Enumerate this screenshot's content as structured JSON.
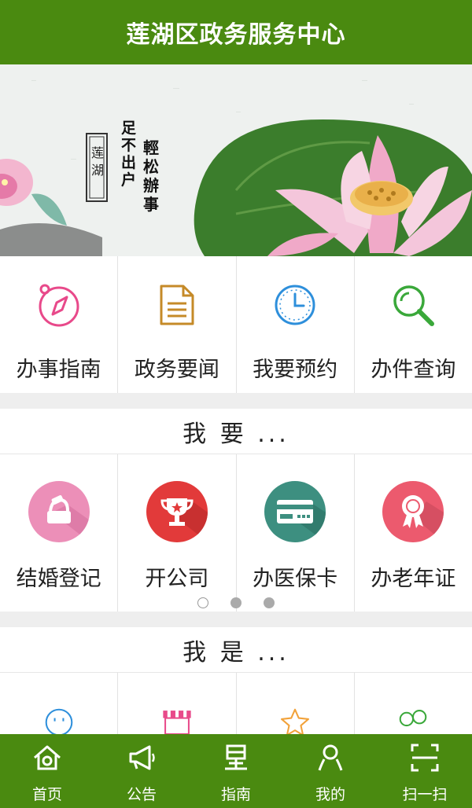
{
  "header": {
    "title": "莲湖区政务服务中心"
  },
  "banner": {
    "seal_text": "莲湖",
    "slogan_left": "足不出户",
    "slogan_right": "輕松辦事"
  },
  "quick_menu": [
    {
      "label": "办事指南",
      "icon": "compass-icon",
      "color": "#e8498a"
    },
    {
      "label": "政务要闻",
      "icon": "document-icon",
      "color": "#c58a28"
    },
    {
      "label": "我要预约",
      "icon": "clock-icon",
      "color": "#2e8fdb"
    },
    {
      "label": "办件查询",
      "icon": "search-icon",
      "color": "#3aa83a"
    }
  ],
  "want_section": {
    "title": "我 要 ...",
    "items": [
      {
        "label": "结婚登记",
        "icon": "ring-box-icon",
        "color": "#ec8fb8"
      },
      {
        "label": "开公司",
        "icon": "trophy-icon",
        "color": "#e23a3a"
      },
      {
        "label": "办医保卡",
        "icon": "card-icon",
        "color": "#3d8f80"
      },
      {
        "label": "办老年证",
        "icon": "medal-icon",
        "color": "#ec5a6e"
      }
    ],
    "pagination": {
      "pages": 3,
      "active_page": 1
    }
  },
  "iam_section": {
    "title": "我 是 ...",
    "items": [
      {
        "icon": "smiley-icon",
        "color": "#2e8fdb"
      },
      {
        "icon": "shop-icon",
        "color": "#e84a8a"
      },
      {
        "icon": "star-icon",
        "color": "#f2a23a"
      },
      {
        "icon": "people-icon",
        "color": "#3aa83a"
      }
    ]
  },
  "tabbar": {
    "items": [
      {
        "label": "首页",
        "icon": "home-icon"
      },
      {
        "label": "公告",
        "icon": "megaphone-icon"
      },
      {
        "label": "指南",
        "icon": "guide-icon"
      },
      {
        "label": "我的",
        "icon": "user-icon"
      },
      {
        "label": "扫一扫",
        "icon": "scan-icon"
      }
    ]
  },
  "colors": {
    "brand_green": "#4a8a10",
    "background": "#eeeeee"
  }
}
